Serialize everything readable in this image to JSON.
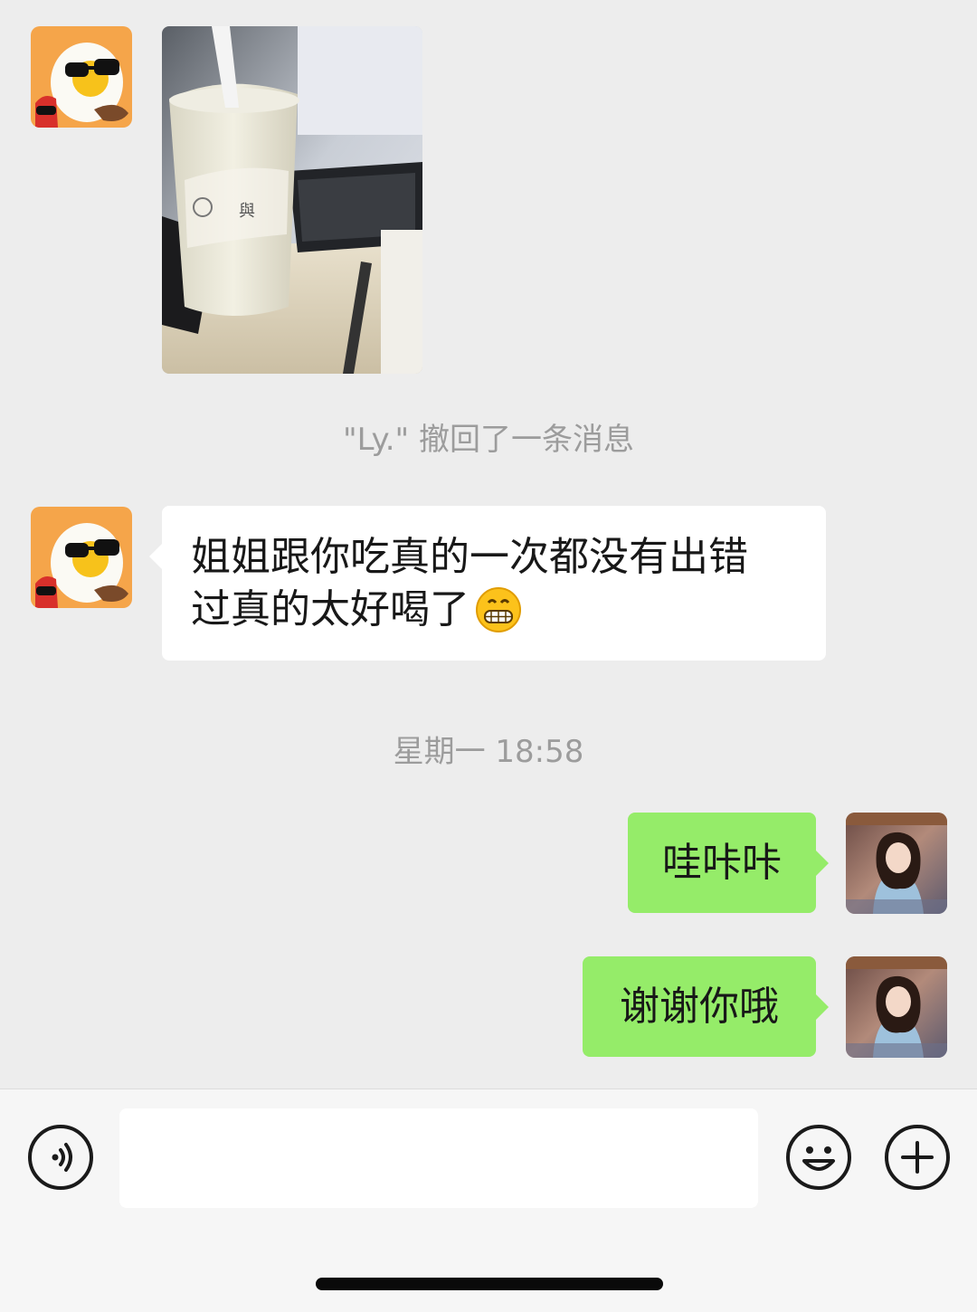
{
  "messages": {
    "recall_notice": "\"Ly.\" 撤回了一条消息",
    "incoming_text_line1": "姐姐跟你吃真的一次都没有出错",
    "incoming_text_line2": "过真的太好喝了",
    "timestamp": "星期一 18:58",
    "outgoing_1": "哇咔咔",
    "outgoing_2": "谢谢你哦"
  },
  "input_bar": {
    "left_icon": "voice-icon",
    "emoji_icon": "emoji-icon",
    "plus_icon": "plus-icon"
  },
  "colors": {
    "background": "#ededed",
    "outgoing_bubble": "#95ec69",
    "incoming_bubble": "#ffffff",
    "system_text": "#9c9c9c"
  }
}
